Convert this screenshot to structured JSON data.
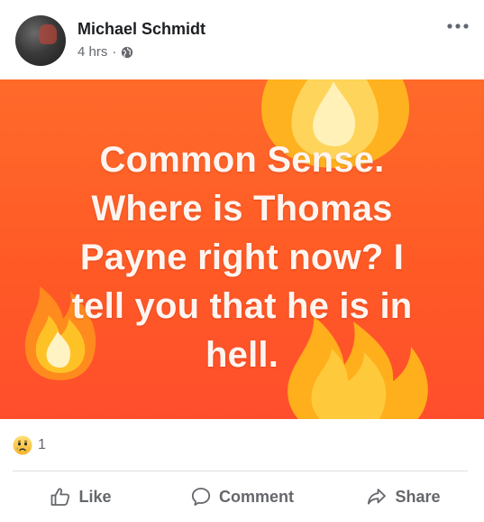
{
  "post": {
    "author": "Michael Schmidt",
    "time": "4 hrs",
    "separator": "·",
    "privacy_icon": "globe-icon",
    "more_icon": "more-options-icon",
    "text": "Common Sense.\nWhere is Thomas\nPayne right now? I\ntell you that he is in\nhell.",
    "background_color": "#ff5a26"
  },
  "reactions": {
    "icon": "sad-reaction-icon",
    "count": "1"
  },
  "actions": {
    "like_label": "Like",
    "comment_label": "Comment",
    "share_label": "Share"
  }
}
